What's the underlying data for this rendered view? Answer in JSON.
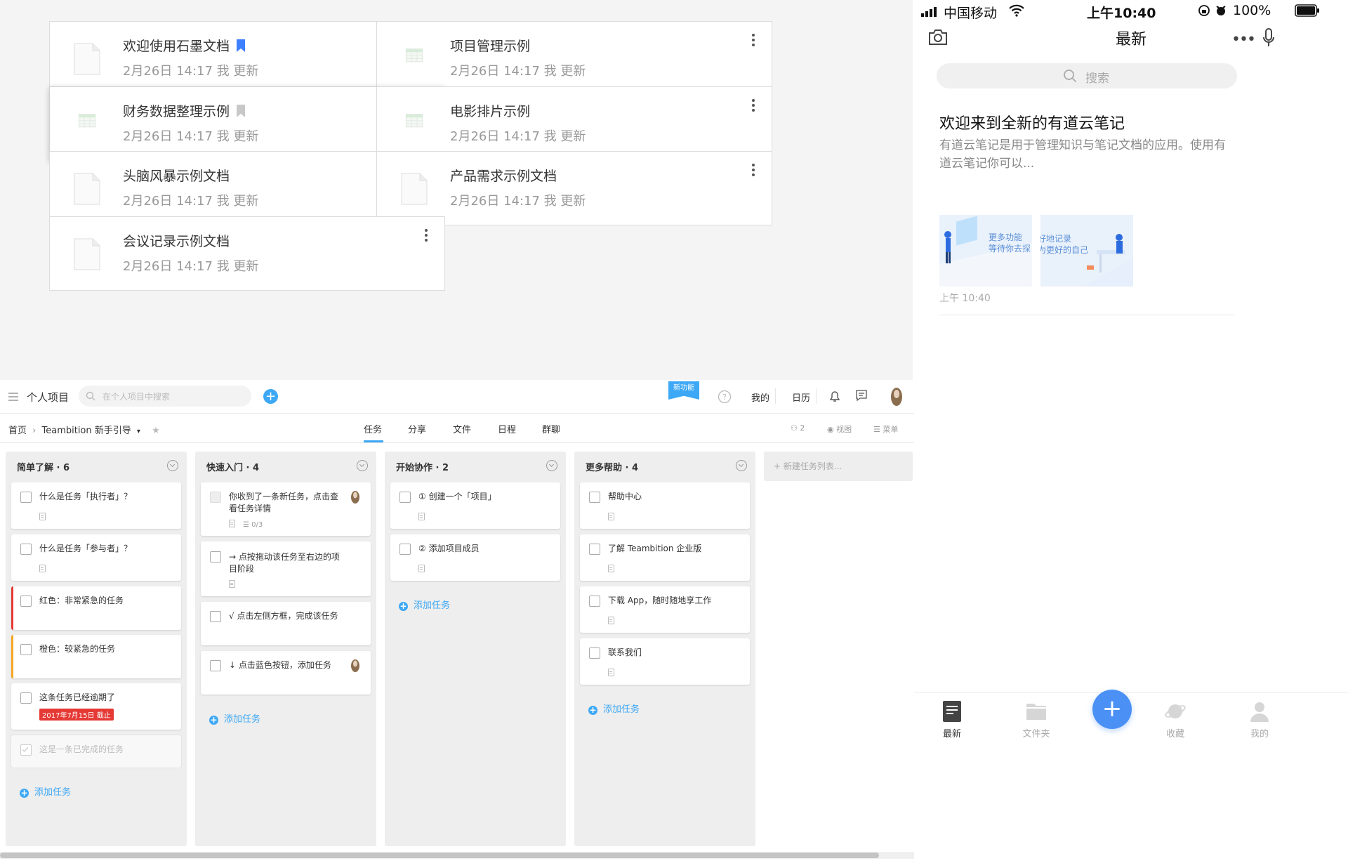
{
  "shimo": {
    "docs": [
      {
        "title": "欢迎使用石墨文档",
        "meta": "2月26日 14:17 我 更新",
        "type": "doc",
        "bookmark": "active"
      },
      {
        "title": "项目管理示例",
        "meta": "2月26日 14:17 我 更新",
        "type": "sheet"
      },
      {
        "title": "财务数据整理示例",
        "meta": "2月26日 14:17 我 更新",
        "type": "sheet",
        "bookmark": "inactive",
        "muted": true
      },
      {
        "title": "电影排片示例",
        "meta": "2月26日 14:17 我 更新",
        "type": "sheet"
      },
      {
        "title": "头脑风暴示例文档",
        "meta": "2月26日 14:17 我 更新",
        "type": "doc"
      },
      {
        "title": "产品需求示例文档",
        "meta": "2月26日 14:17 我 更新",
        "type": "doc"
      },
      {
        "title": "会议记录示例文档",
        "meta": "2月26日 14:17 我 更新",
        "type": "doc"
      }
    ],
    "colors": {
      "bookmark_active": "#3d7fff",
      "bookmark_inactive": "#c8c8c8",
      "sheet_green": "#d7ecd9"
    }
  },
  "teambition": {
    "project_name": "个人项目",
    "search_placeholder": "在个人项目中搜索",
    "new_badge": "新功能",
    "top_links": [
      "我的",
      "日历"
    ],
    "breadcrumb": {
      "home": "首页",
      "project": "Teambition 新手引导"
    },
    "tabs": [
      "任务",
      "分享",
      "文件",
      "日程",
      "群聊"
    ],
    "active_tab": "任务",
    "right_tools": {
      "members": "2",
      "view": "视图",
      "menu": "菜单"
    },
    "new_list_placeholder": "新建任务列表...",
    "add_task_label": "添加任务",
    "columns": [
      {
        "title": "简单了解 · 6",
        "tasks": [
          {
            "text": "什么是任务「执行者」？"
          },
          {
            "text": "什么是任务「参与者」？"
          },
          {
            "text": "红色：非常紧急的任务",
            "priority": "red"
          },
          {
            "text": "橙色：较紧急的任务",
            "priority": "orange"
          },
          {
            "text": "这条任务已经逾期了",
            "due": "2017年7月15日 截止"
          },
          {
            "text": "这是一条已完成的任务",
            "done": true
          }
        ]
      },
      {
        "title": "快速入门 · 4",
        "tasks": [
          {
            "text": "你收到了一条新任务，点击查看任务详情",
            "subtasks": "0/3",
            "avatar": true
          },
          {
            "text": "→ 点按拖动该任务至右边的项目阶段"
          },
          {
            "text": "√ 点击左侧方框，完成该任务"
          },
          {
            "text": "↓ 点击蓝色按钮，添加任务",
            "avatar": true
          }
        ]
      },
      {
        "title": "开始协作 · 2",
        "tasks": [
          {
            "text": "① 创建一个「项目」"
          },
          {
            "text": "② 添加项目成员"
          }
        ]
      },
      {
        "title": "更多帮助 · 4",
        "tasks": [
          {
            "text": "帮助中心"
          },
          {
            "text": "了解 Teambition 企业版"
          },
          {
            "text": "下载 App，随时随地享工作"
          },
          {
            "text": "联系我们"
          }
        ]
      }
    ],
    "colors": {
      "accent": "#3da8f5",
      "urgent": "#e53935",
      "warning": "#f5a623"
    }
  },
  "youdao": {
    "status": {
      "carrier": "中国移动",
      "time": "上午10:40",
      "battery": "100%"
    },
    "header_title": "最新",
    "search_placeholder": "搜索",
    "note": {
      "title": "欢迎来到全新的有道云笔记",
      "preview": "有道云笔记是用于管理知识与笔记文档的应用。使用有道云笔记你可以...",
      "thumb1_text": [
        "更多功能",
        "等待你去探"
      ],
      "thumb2_text": [
        "好地记录",
        "为更好的自己"
      ],
      "time": "上午 10:40"
    },
    "tabs": [
      "最新",
      "文件夹",
      "收藏",
      "我的"
    ],
    "active_tab": "最新",
    "colors": {
      "accent": "#4a90f5"
    }
  }
}
